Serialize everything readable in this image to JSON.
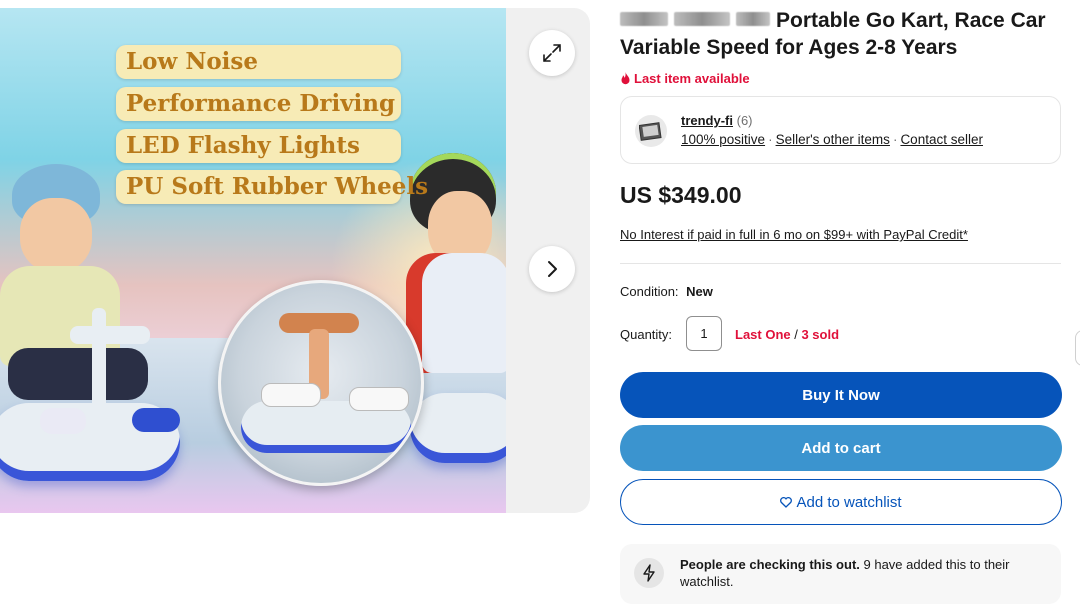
{
  "gallery": {
    "features": [
      "Low Noise",
      "Performance Driving",
      "LED Flashy Lights",
      "PU Soft Rubber Wheels"
    ],
    "expand_icon": "expand-arrows-icon",
    "next_icon": "chevron-right-icon"
  },
  "listing": {
    "title_text": "Portable Go Kart, Race Car Variable Speed for Ages 2-8 Years",
    "urgency": "Last item available",
    "price": "US $349.00",
    "credit_offer": "No Interest if paid in full in 6 mo on $99+ with PayPal Credit*",
    "condition_label": "Condition:",
    "condition_value": "New",
    "quantity_label": "Quantity:",
    "quantity_value": "1",
    "stock_last": "Last One",
    "stock_sep": " / ",
    "stock_sold": "3 sold"
  },
  "seller": {
    "name": "trendy-fi",
    "feedback_count": "(6)",
    "positive": "100% positive",
    "other_items": "Seller's other items",
    "contact": "Contact seller"
  },
  "actions": {
    "buy_now": "Buy It Now",
    "add_to_cart": "Add to cart",
    "add_to_watchlist": "Add to watchlist"
  },
  "signal": {
    "bold": "People are checking this out.",
    "rest": " 9 have added this to their watchlist."
  },
  "colors": {
    "primary_blue": "#0654ba",
    "cart_blue": "#3b94cf",
    "urgent_red": "#e0103a"
  }
}
